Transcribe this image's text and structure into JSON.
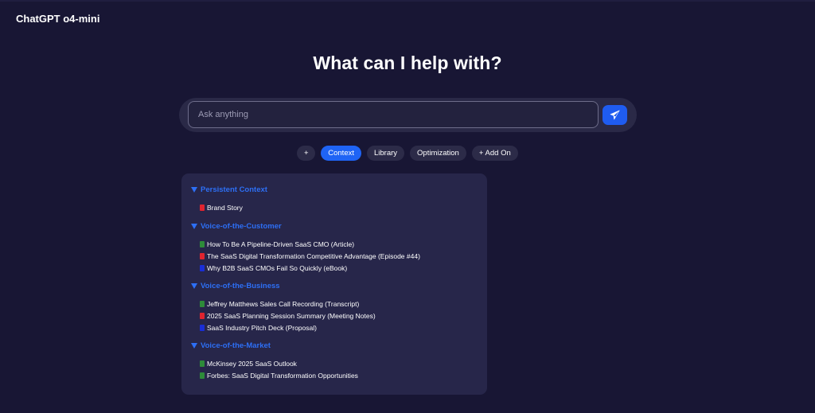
{
  "app": {
    "title": "ChatGPT o4-mini"
  },
  "hero": {
    "headline": "What can I help with?"
  },
  "prompt": {
    "placeholder": "Ask anything",
    "value": ""
  },
  "toolbar": {
    "pills": [
      {
        "label": "+",
        "active": false
      },
      {
        "label": "Context",
        "active": true
      },
      {
        "label": "Library",
        "active": false
      },
      {
        "label": "Optimization",
        "active": false
      },
      {
        "label": "+ Add On",
        "active": false
      }
    ]
  },
  "context_panel": {
    "sections": [
      {
        "title": "Persistent Context",
        "items": [
          {
            "label": "Brand Story",
            "icon": "red-document-icon",
            "color": "#e0242f"
          }
        ]
      },
      {
        "title": "Voice-of-the-Customer",
        "items": [
          {
            "label": "How To Be A Pipeline-Driven SaaS CMO (Article)",
            "icon": "green-document-icon",
            "color": "#2e8b3a"
          },
          {
            "label": "The SaaS Digital Transformation Competitive Advantage (Episode #44)",
            "icon": "red-document-icon",
            "color": "#e0242f"
          },
          {
            "label": "Why B2B SaaS CMOs Fail So Quickly (eBook)",
            "icon": "blue-document-icon",
            "color": "#1a2ed6"
          }
        ]
      },
      {
        "title": "Voice-of-the-Business",
        "items": [
          {
            "label": "Jeffrey Matthews Sales Call Recording (Transcript)",
            "icon": "green-document-icon",
            "color": "#2e8b3a"
          },
          {
            "label": "2025 SaaS Planning Session Summary (Meeting Notes)",
            "icon": "red-document-icon",
            "color": "#e0242f"
          },
          {
            "label": "SaaS Industry Pitch Deck (Proposal)",
            "icon": "blue-document-icon",
            "color": "#1a2ed6"
          }
        ]
      },
      {
        "title": "Voice-of-the-Market",
        "items": [
          {
            "label": "McKinsey 2025 SaaS Outlook",
            "icon": "green-document-icon",
            "color": "#2e8b3a"
          },
          {
            "label": "Forbes: SaaS Digital Transformation Opportunities",
            "icon": "green-document-icon",
            "color": "#2e8b3a"
          }
        ]
      }
    ]
  },
  "colors": {
    "background": "#181634",
    "accent": "#1f64f5",
    "section_heading": "#2d6ff5"
  }
}
